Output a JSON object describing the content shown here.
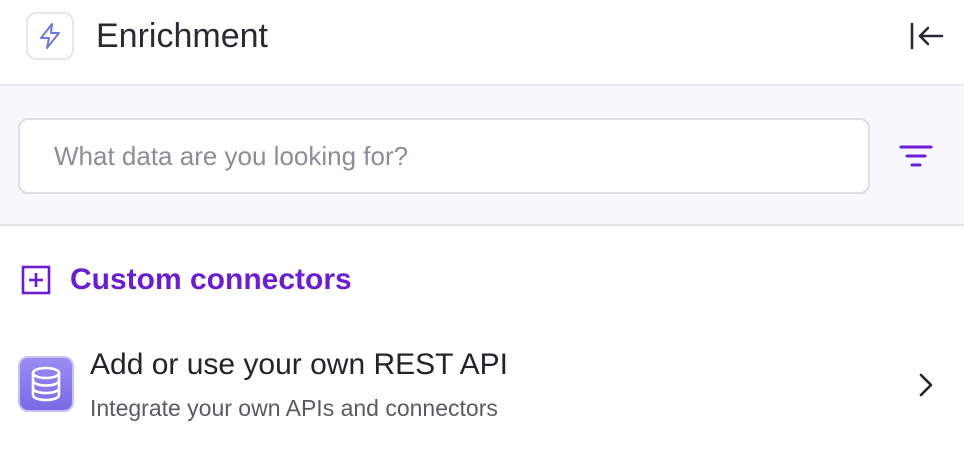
{
  "header": {
    "title": "Enrichment",
    "app_icon": "lightning-bolt-icon",
    "collapse_icon": "collapse-left-icon"
  },
  "search": {
    "value": "",
    "placeholder": "What data are you looking for?",
    "filter_icon": "filter-icon"
  },
  "section": {
    "title": "Custom connectors",
    "icon": "plus-square-icon"
  },
  "connectors": [
    {
      "title": "Add or use your own REST API",
      "subtitle": "Integrate your own APIs and connectors",
      "icon": "database-icon",
      "chevron": "chevron-right-icon"
    }
  ],
  "colors": {
    "accent": "#6c1dd0",
    "band_background": "#f7f7fd",
    "icon_tile": "#8c7cee",
    "bolt": "#6f78d8"
  }
}
